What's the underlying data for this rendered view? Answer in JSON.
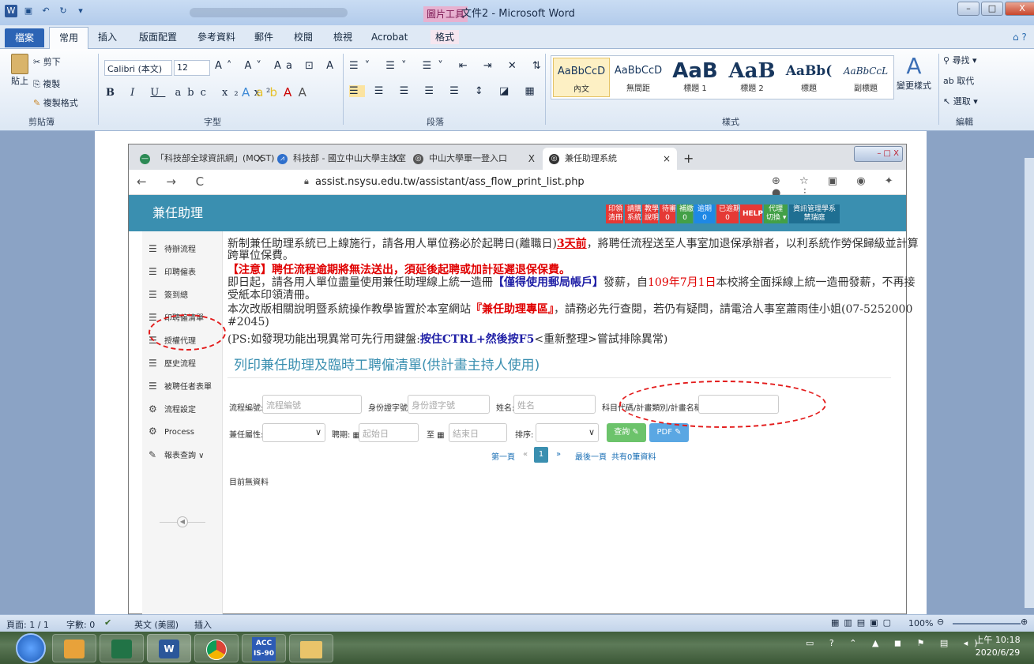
{
  "word": {
    "window_title": "文件2 - Microsoft Word",
    "tools_tab": "圖片工具",
    "ribbon_tabs": [
      "檔案",
      "常用",
      "插入",
      "版面配置",
      "參考資料",
      "郵件",
      "校閱",
      "檢視",
      "Acrobat",
      "格式"
    ],
    "clipboard": {
      "paste": "貼上",
      "cut": "剪下",
      "copy": "複製",
      "format_painter": "複製格式",
      "label": "剪貼簿"
    },
    "font": {
      "name": "Calibri (本文)",
      "size": "12",
      "label": "字型"
    },
    "paragraph_label": "段落",
    "styles": {
      "items": [
        {
          "preview": "AaBbCcD",
          "name": "內文"
        },
        {
          "preview": "AaBbCcD",
          "name": "無間距"
        },
        {
          "preview": "AaB",
          "name": "標題 1"
        },
        {
          "preview": "AaB",
          "name": "標題 2"
        },
        {
          "preview": "AaBb(",
          "name": "標題"
        },
        {
          "preview": "AaBbCcL",
          "name": "副標題"
        }
      ],
      "change_styles": "變更樣式",
      "label": "樣式"
    },
    "editing": {
      "find": "尋找",
      "replace": "取代",
      "select": "選取",
      "label": "編輯"
    },
    "status": {
      "page": "頁面: 1 / 1",
      "words": "字數: 0",
      "language": "英文 (美國)",
      "mode": "插入",
      "zoom": "100%"
    }
  },
  "browser": {
    "tabs": [
      {
        "title": "「科技部全球資訊網」(MOST)",
        "close": "X"
      },
      {
        "title": "科技部 - 國立中山大學主計室",
        "close": "X"
      },
      {
        "title": "中山大學單一登入口",
        "close": "X"
      },
      {
        "title": "兼任助理系統",
        "close": "×"
      }
    ],
    "new_tab": "+",
    "url": "assist.nsysu.edu.tw/assistant/ass_flow_print_list.php"
  },
  "app": {
    "title": "兼任助理",
    "top_buttons": [
      {
        "label": "印領\n清冊",
        "color": "#e53935"
      },
      {
        "label": "請購\n系統",
        "color": "#e53935"
      },
      {
        "label": "教學\n說明",
        "color": "#e53935"
      },
      {
        "label": "待審\n0",
        "color": "#e53935"
      },
      {
        "label": "補繳\n0",
        "color": "#43a047"
      },
      {
        "label": "逾期\n0",
        "color": "#1e88e5"
      },
      {
        "label": "已逾期\n0",
        "color": "#e53935"
      },
      {
        "label": "HELP",
        "color": "#e53935"
      },
      {
        "label": "代理\n切換 ▾",
        "color": "#43a047"
      },
      {
        "label": "資訊管理學系\n禁瑞庭",
        "color": "#1f6f92"
      }
    ],
    "sidebar": [
      {
        "icon": "☰",
        "label": "待辦流程",
        "icon_name": "list-icon"
      },
      {
        "icon": "☰",
        "label": "印聘僱表",
        "icon_name": "list-icon"
      },
      {
        "icon": "☰",
        "label": "簽到總",
        "icon_name": "list-icon"
      },
      {
        "icon": "☰",
        "label": "印聘僱清單",
        "icon_name": "list-icon"
      },
      {
        "icon": "☰",
        "label": "授權代理",
        "icon_name": "list-icon"
      },
      {
        "icon": "☰",
        "label": "歷史流程",
        "icon_name": "list-icon"
      },
      {
        "icon": "☰",
        "label": "被聘任者表單",
        "icon_name": "list-icon"
      },
      {
        "icon": "⚙",
        "label": "流程設定",
        "icon_name": "gears-icon"
      },
      {
        "icon": "⚙",
        "label": "Process",
        "icon_name": "gears-icon"
      },
      {
        "icon": "✎",
        "label": "報表查詢 ∨",
        "icon_name": "edit-icon"
      }
    ],
    "collapse": "◀",
    "notice": {
      "l1": "新制兼任助理系統已上線施行，請各用人單位務必於起聘日(離職日)",
      "l1_red": "3天前",
      "l1_end": "，將聘任流程送至人事室加退保承辦者，以利系統作勞保歸級並計算",
      "l2": "跨單位保費。",
      "l3_red": "【注意】聘任流程逾期將無法送出，須延後起聘或加計延遲退保保費。",
      "l4a": "即日起，請各用人單位盡量使用兼任助理線上統一造冊",
      "l4_blue": "【僅得使用郵局帳戶】",
      "l4b": "發薪，自",
      "l4_date": "109年7月1日",
      "l4c": "本校將全面採線上統一造冊發薪，不再接",
      "l5": "受紙本印領清冊。",
      "l6a": "本次改版相關說明暨系統操作教學皆置於本室網站",
      "l6_red": "『兼任助理專區』",
      "l6b": "，請務必先行查閱，若仍有疑問，請電洽人事室蕭雨佳小姐(07-5252000",
      "l7": "#2045)",
      "l8a": "(PS:如發現功能出現異常可先行用鍵盤:",
      "l8_bold": "按住CTRL+然後按F5",
      "l8b": "<重新整理>嘗試排除異常)"
    },
    "page_title": "列印兼任助理及臨時工聘僱清單(供計畫主持人使用)",
    "form": {
      "flow_no_label": "流程編號:",
      "flow_no_ph": "流程編號",
      "id_label": "身份證字號:",
      "id_ph": "身份證字號",
      "name_label": "姓名:",
      "name_ph": "姓名",
      "project_label": "科目代碼/計畫類別/計畫名稱:",
      "project_ph": "",
      "type_label": "兼任屬性:",
      "hire_label": "聘期:",
      "start_ph": "起始日",
      "to_label": "至",
      "end_ph": "結束日",
      "sort_label": "排序:",
      "query_btn": "查詢",
      "pdf_btn": "PDF"
    },
    "pagination": {
      "first": "第一頁",
      "prev": "«",
      "current": "1",
      "next": "»",
      "last": "最後一頁",
      "total": "共有0筆資料"
    },
    "empty": "目前無資料"
  },
  "taskbar": {
    "acc_label": "ACC\nIS-90",
    "time": "上午 10:18",
    "date": "2020/6/29"
  }
}
